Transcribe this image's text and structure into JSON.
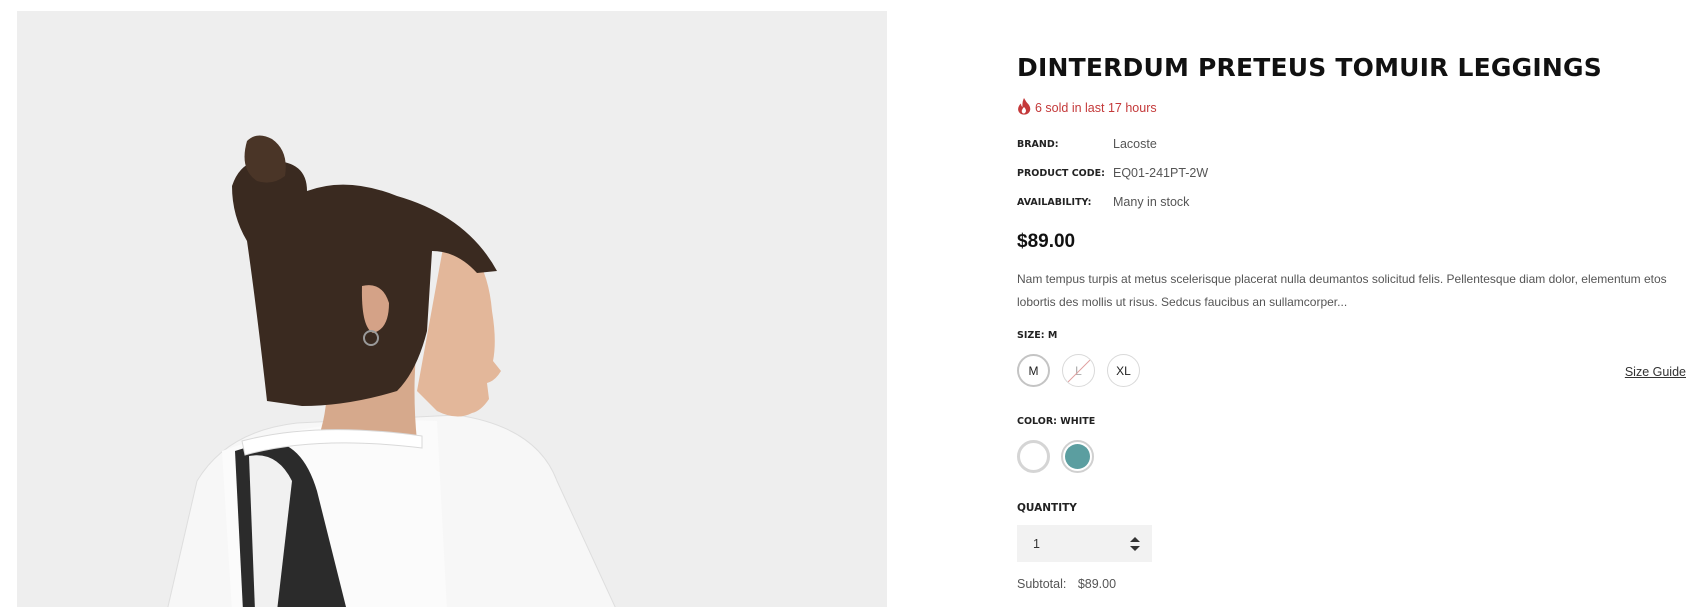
{
  "product": {
    "title": "DINTERDUM PRETEUS TOMUIR LEGGINGS",
    "sold_text": "6 sold in last 17 hours",
    "sold_icon": "flame-icon",
    "meta": [
      {
        "label": "BRAND:",
        "value": "Lacoste"
      },
      {
        "label": "PRODUCT CODE:",
        "value": "EQ01-241PT-2W"
      },
      {
        "label": "AVAILABILITY:",
        "value": "Many in stock"
      }
    ],
    "price": "$89.00",
    "description": "Nam tempus turpis at metus scelerisque placerat nulla deumantos solicitud felis. Pellentesque diam dolor, elementum etos lobortis des mollis ut risus. Sedcus faucibus an sullamcorper...",
    "size": {
      "label": "SIZE: M",
      "options": [
        {
          "label": "M",
          "state": "selected"
        },
        {
          "label": "L",
          "state": "unavailable"
        },
        {
          "label": "XL",
          "state": "available"
        }
      ],
      "guide_label": "Size Guide"
    },
    "color": {
      "label": "COLOR: WHITE",
      "swatches": [
        {
          "name": "White",
          "hex": "#ffffff"
        },
        {
          "name": "Teal",
          "hex": "#5b9ea0"
        }
      ]
    },
    "quantity": {
      "label": "QUANTITY",
      "value": "1"
    },
    "subtotal": {
      "label": "Subtotal:",
      "value": "$89.00"
    }
  },
  "colors": {
    "accent_red": "#c4393a",
    "image_bg": "#eeeeee"
  }
}
